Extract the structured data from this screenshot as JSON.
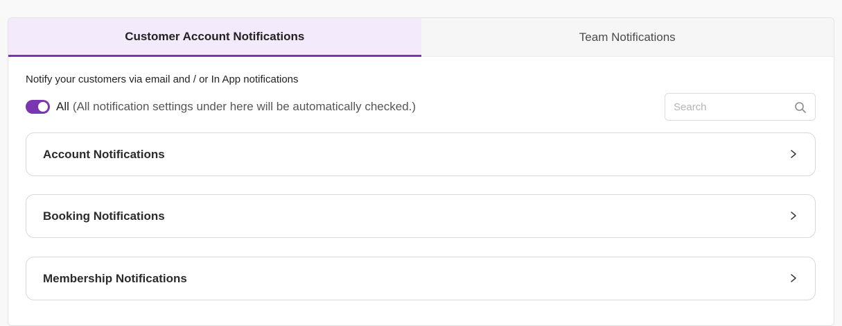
{
  "tabs": [
    {
      "label": "Customer Account Notifications",
      "active": true
    },
    {
      "label": "Team Notifications",
      "active": false
    }
  ],
  "description": "Notify your customers via email and / or In App notifications",
  "all_toggle": {
    "label": "All",
    "note": "(All notification settings under here will be automatically checked.)",
    "checked": true
  },
  "search": {
    "placeholder": "Search",
    "value": ""
  },
  "sections": [
    {
      "title": "Account Notifications"
    },
    {
      "title": "Booking Notifications"
    },
    {
      "title": "Membership Notifications"
    }
  ],
  "colors": {
    "accent": "#7a36b1",
    "active_tab_bg": "#f3ebfc"
  },
  "icons": {
    "search": "search-icon",
    "chevron": "chevron-right-icon"
  }
}
